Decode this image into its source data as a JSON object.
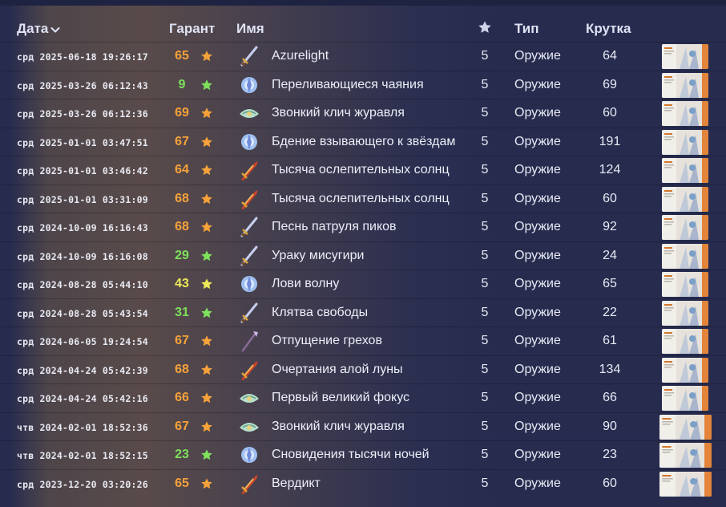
{
  "colors": {
    "orange": "#f5a23a",
    "green": "#7ee05c",
    "yellow": "#ece85a",
    "background": "#272c4f"
  },
  "header": {
    "date_label": "Дата",
    "sort_icon": "chevron-down-icon",
    "guarantee_label": "Гарант",
    "name_label": "Имя",
    "rarity_icon": "star-icon",
    "type_label": "Тип",
    "pull_label": "Крутка"
  },
  "rows": [
    {
      "date": "срд 2025-06-18 19:26:17",
      "guarantee": "65",
      "guarantee_color": "orange",
      "name": "Azurelight",
      "icon": "sword-icon",
      "rarity": "5",
      "type": "Оружие",
      "pull": "64",
      "banner": "banner-thumbnail"
    },
    {
      "date": "срд 2025-03-26 06:12:43",
      "guarantee": "9",
      "guarantee_color": "green",
      "name": "Переливающиеся чаяния",
      "icon": "catalyst-icon",
      "rarity": "5",
      "type": "Оружие",
      "pull": "69",
      "banner": "banner-thumbnail"
    },
    {
      "date": "срд 2025-03-26 06:12:36",
      "guarantee": "69",
      "guarantee_color": "orange",
      "name": "Звонкий клич журавля",
      "icon": "bow-icon",
      "rarity": "5",
      "type": "Оружие",
      "pull": "60",
      "banner": "banner-thumbnail"
    },
    {
      "date": "срд 2025-01-01 03:47:51",
      "guarantee": "67",
      "guarantee_color": "orange",
      "name": "Бдение взывающего к звёздам",
      "icon": "catalyst-icon",
      "rarity": "5",
      "type": "Оружие",
      "pull": "191",
      "banner": "banner-thumbnail"
    },
    {
      "date": "срд 2025-01-01 03:46:42",
      "guarantee": "64",
      "guarantee_color": "orange",
      "name": "Тысяча ослепительных солнц",
      "icon": "claymore-icon",
      "rarity": "5",
      "type": "Оружие",
      "pull": "124",
      "banner": "banner-thumbnail"
    },
    {
      "date": "срд 2025-01-01 03:31:09",
      "guarantee": "68",
      "guarantee_color": "orange",
      "name": "Тысяча ослепительных солнц",
      "icon": "claymore-icon",
      "rarity": "5",
      "type": "Оружие",
      "pull": "60",
      "banner": "banner-thumbnail"
    },
    {
      "date": "срд 2024-10-09 16:16:43",
      "guarantee": "68",
      "guarantee_color": "orange",
      "name": "Песнь патруля пиков",
      "icon": "sword-icon",
      "rarity": "5",
      "type": "Оружие",
      "pull": "92",
      "banner": "banner-thumbnail"
    },
    {
      "date": "срд 2024-10-09 16:16:08",
      "guarantee": "29",
      "guarantee_color": "green",
      "name": "Ураку мисугири",
      "icon": "sword-icon",
      "rarity": "5",
      "type": "Оружие",
      "pull": "24",
      "banner": "banner-thumbnail"
    },
    {
      "date": "срд 2024-08-28 05:44:10",
      "guarantee": "43",
      "guarantee_color": "yellow",
      "name": "Лови волну",
      "icon": "catalyst-icon",
      "rarity": "5",
      "type": "Оружие",
      "pull": "65",
      "banner": "banner-thumbnail"
    },
    {
      "date": "срд 2024-08-28 05:43:54",
      "guarantee": "31",
      "guarantee_color": "green",
      "name": "Клятва свободы",
      "icon": "sword-icon",
      "rarity": "5",
      "type": "Оружие",
      "pull": "22",
      "banner": "banner-thumbnail"
    },
    {
      "date": "срд 2024-06-05 19:24:54",
      "guarantee": "67",
      "guarantee_color": "orange",
      "name": "Отпущение грехов",
      "icon": "polearm-icon",
      "rarity": "5",
      "type": "Оружие",
      "pull": "61",
      "banner": "banner-thumbnail"
    },
    {
      "date": "срд 2024-04-24 05:42:39",
      "guarantee": "68",
      "guarantee_color": "orange",
      "name": "Очертания алой луны",
      "icon": "claymore-icon",
      "rarity": "5",
      "type": "Оружие",
      "pull": "134",
      "banner": "banner-thumbnail"
    },
    {
      "date": "срд 2024-04-24 05:42:16",
      "guarantee": "66",
      "guarantee_color": "orange",
      "name": "Первый великий фокус",
      "icon": "bow-icon",
      "rarity": "5",
      "type": "Оружие",
      "pull": "66",
      "banner": "banner-thumbnail"
    },
    {
      "date": "чтв 2024-02-01 18:52:36",
      "guarantee": "67",
      "guarantee_color": "orange",
      "name": "Звонкий клич журавля",
      "icon": "bow-icon",
      "rarity": "5",
      "type": "Оружие",
      "pull": "90",
      "banner": "banner-thumbnail"
    },
    {
      "date": "чтв 2024-02-01 18:52:15",
      "guarantee": "23",
      "guarantee_color": "green",
      "name": "Сновидения тысячи ночей",
      "icon": "catalyst-icon",
      "rarity": "5",
      "type": "Оружие",
      "pull": "23",
      "banner": "banner-thumbnail"
    },
    {
      "date": "срд 2023-12-20 03:20:26",
      "guarantee": "65",
      "guarantee_color": "orange",
      "name": "Вердикт",
      "icon": "claymore-icon",
      "rarity": "5",
      "type": "Оружие",
      "pull": "60",
      "banner": "banner-thumbnail"
    }
  ]
}
